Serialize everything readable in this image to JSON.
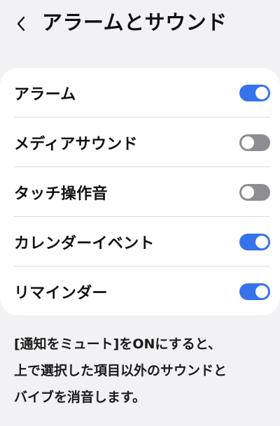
{
  "header": {
    "title": "アラームとサウンド",
    "back_icon": "chevron-left-icon"
  },
  "settings": [
    {
      "label": "アラーム",
      "enabled": true
    },
    {
      "label": "メディアサウンド",
      "enabled": false
    },
    {
      "label": "タッチ操作音",
      "enabled": false
    },
    {
      "label": "カレンダーイベント",
      "enabled": true
    },
    {
      "label": "リマインダー",
      "enabled": true
    }
  ],
  "description": {
    "lines": [
      "[通知をミュート]をONにすると、",
      "上で選択した項目以外のサウンドと",
      "バイブを消音します。"
    ]
  },
  "colors": {
    "background": "#f2f2f4",
    "card": "#ffffff",
    "toggle_on": "#3673ea",
    "toggle_off": "#8d8d92"
  }
}
